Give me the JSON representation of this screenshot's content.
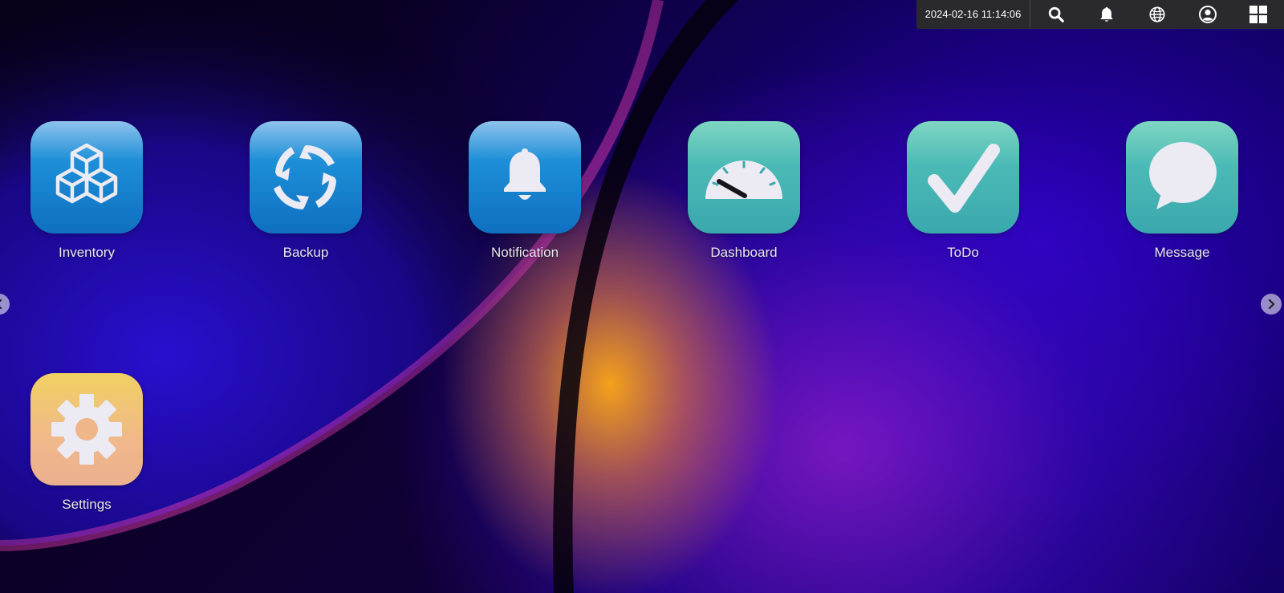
{
  "topbar": {
    "datetime": "2024-02-16 11:14:06",
    "buttons": [
      {
        "icon": "search-icon"
      },
      {
        "icon": "bell-icon"
      },
      {
        "icon": "globe-icon"
      },
      {
        "icon": "user-icon"
      },
      {
        "icon": "windows-grid-icon"
      }
    ]
  },
  "desktop": {
    "apps": [
      {
        "label": "Inventory",
        "icon": "cubes-icon"
      },
      {
        "label": "Backup",
        "icon": "sync-icon"
      },
      {
        "label": "Notification",
        "icon": "bell-icon"
      },
      {
        "label": "Dashboard",
        "icon": "gauge-icon"
      },
      {
        "label": "ToDo",
        "icon": "checkmark-icon"
      },
      {
        "label": "Message",
        "icon": "chat-bubble-icon"
      },
      {
        "label": "Settings",
        "icon": "gear-icon"
      }
    ]
  },
  "colors": {
    "topbar_bg": "#2a2a2e",
    "blue_tile": "#1d8fd8",
    "teal_tile": "#4bbab6",
    "peach_tile": "#f0b88b",
    "glyph": "#eceaf2"
  }
}
